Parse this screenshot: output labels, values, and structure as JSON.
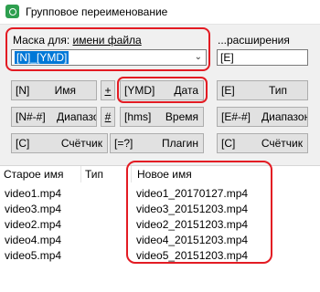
{
  "window": {
    "title": "Групповое переименование"
  },
  "mask": {
    "label_prefix": "Маска для: ",
    "label_underlined": "имени файла",
    "value": "[N]_[YMD]"
  },
  "extension": {
    "label": "...расширения",
    "value": "[E]"
  },
  "buttons": {
    "name": {
      "code": "[N]",
      "label": "Имя"
    },
    "plus": "+",
    "date": {
      "code": "[YMD]",
      "label": "Дата"
    },
    "ext_type": {
      "code": "[E]",
      "label": "Тип"
    },
    "range": {
      "code": "[N#-#]",
      "label": "Диапазон"
    },
    "hash": "#",
    "time": {
      "code": "[hms]",
      "label": "Время"
    },
    "ext_range": {
      "code": "[E#-#]",
      "label": "Диапазон"
    },
    "counter": {
      "code": "[C]",
      "label": "Счётчик"
    },
    "plugin": {
      "code": "[=?]",
      "label": "Плагин"
    },
    "ext_counter": {
      "code": "[C]",
      "label": "Счётчик"
    }
  },
  "grid": {
    "columns": [
      "Старое имя",
      "Тип",
      "Новое имя"
    ],
    "rows": [
      {
        "old": "video1.mp4",
        "type": "",
        "new": "video1_20170127.mp4"
      },
      {
        "old": "video3.mp4",
        "type": "",
        "new": "video3_20151203.mp4"
      },
      {
        "old": "video2.mp4",
        "type": "",
        "new": "video2_20151203.mp4"
      },
      {
        "old": "video4.mp4",
        "type": "",
        "new": "video4_20151203.mp4"
      },
      {
        "old": "video5.mp4",
        "type": "",
        "new": "video5_20151203.mp4"
      }
    ]
  },
  "colors": {
    "highlight_outline": "#e31b23",
    "selection": "#0078d7"
  },
  "icons": {
    "app": "rename-app-icon",
    "dropdown": "chevron-down-icon"
  }
}
